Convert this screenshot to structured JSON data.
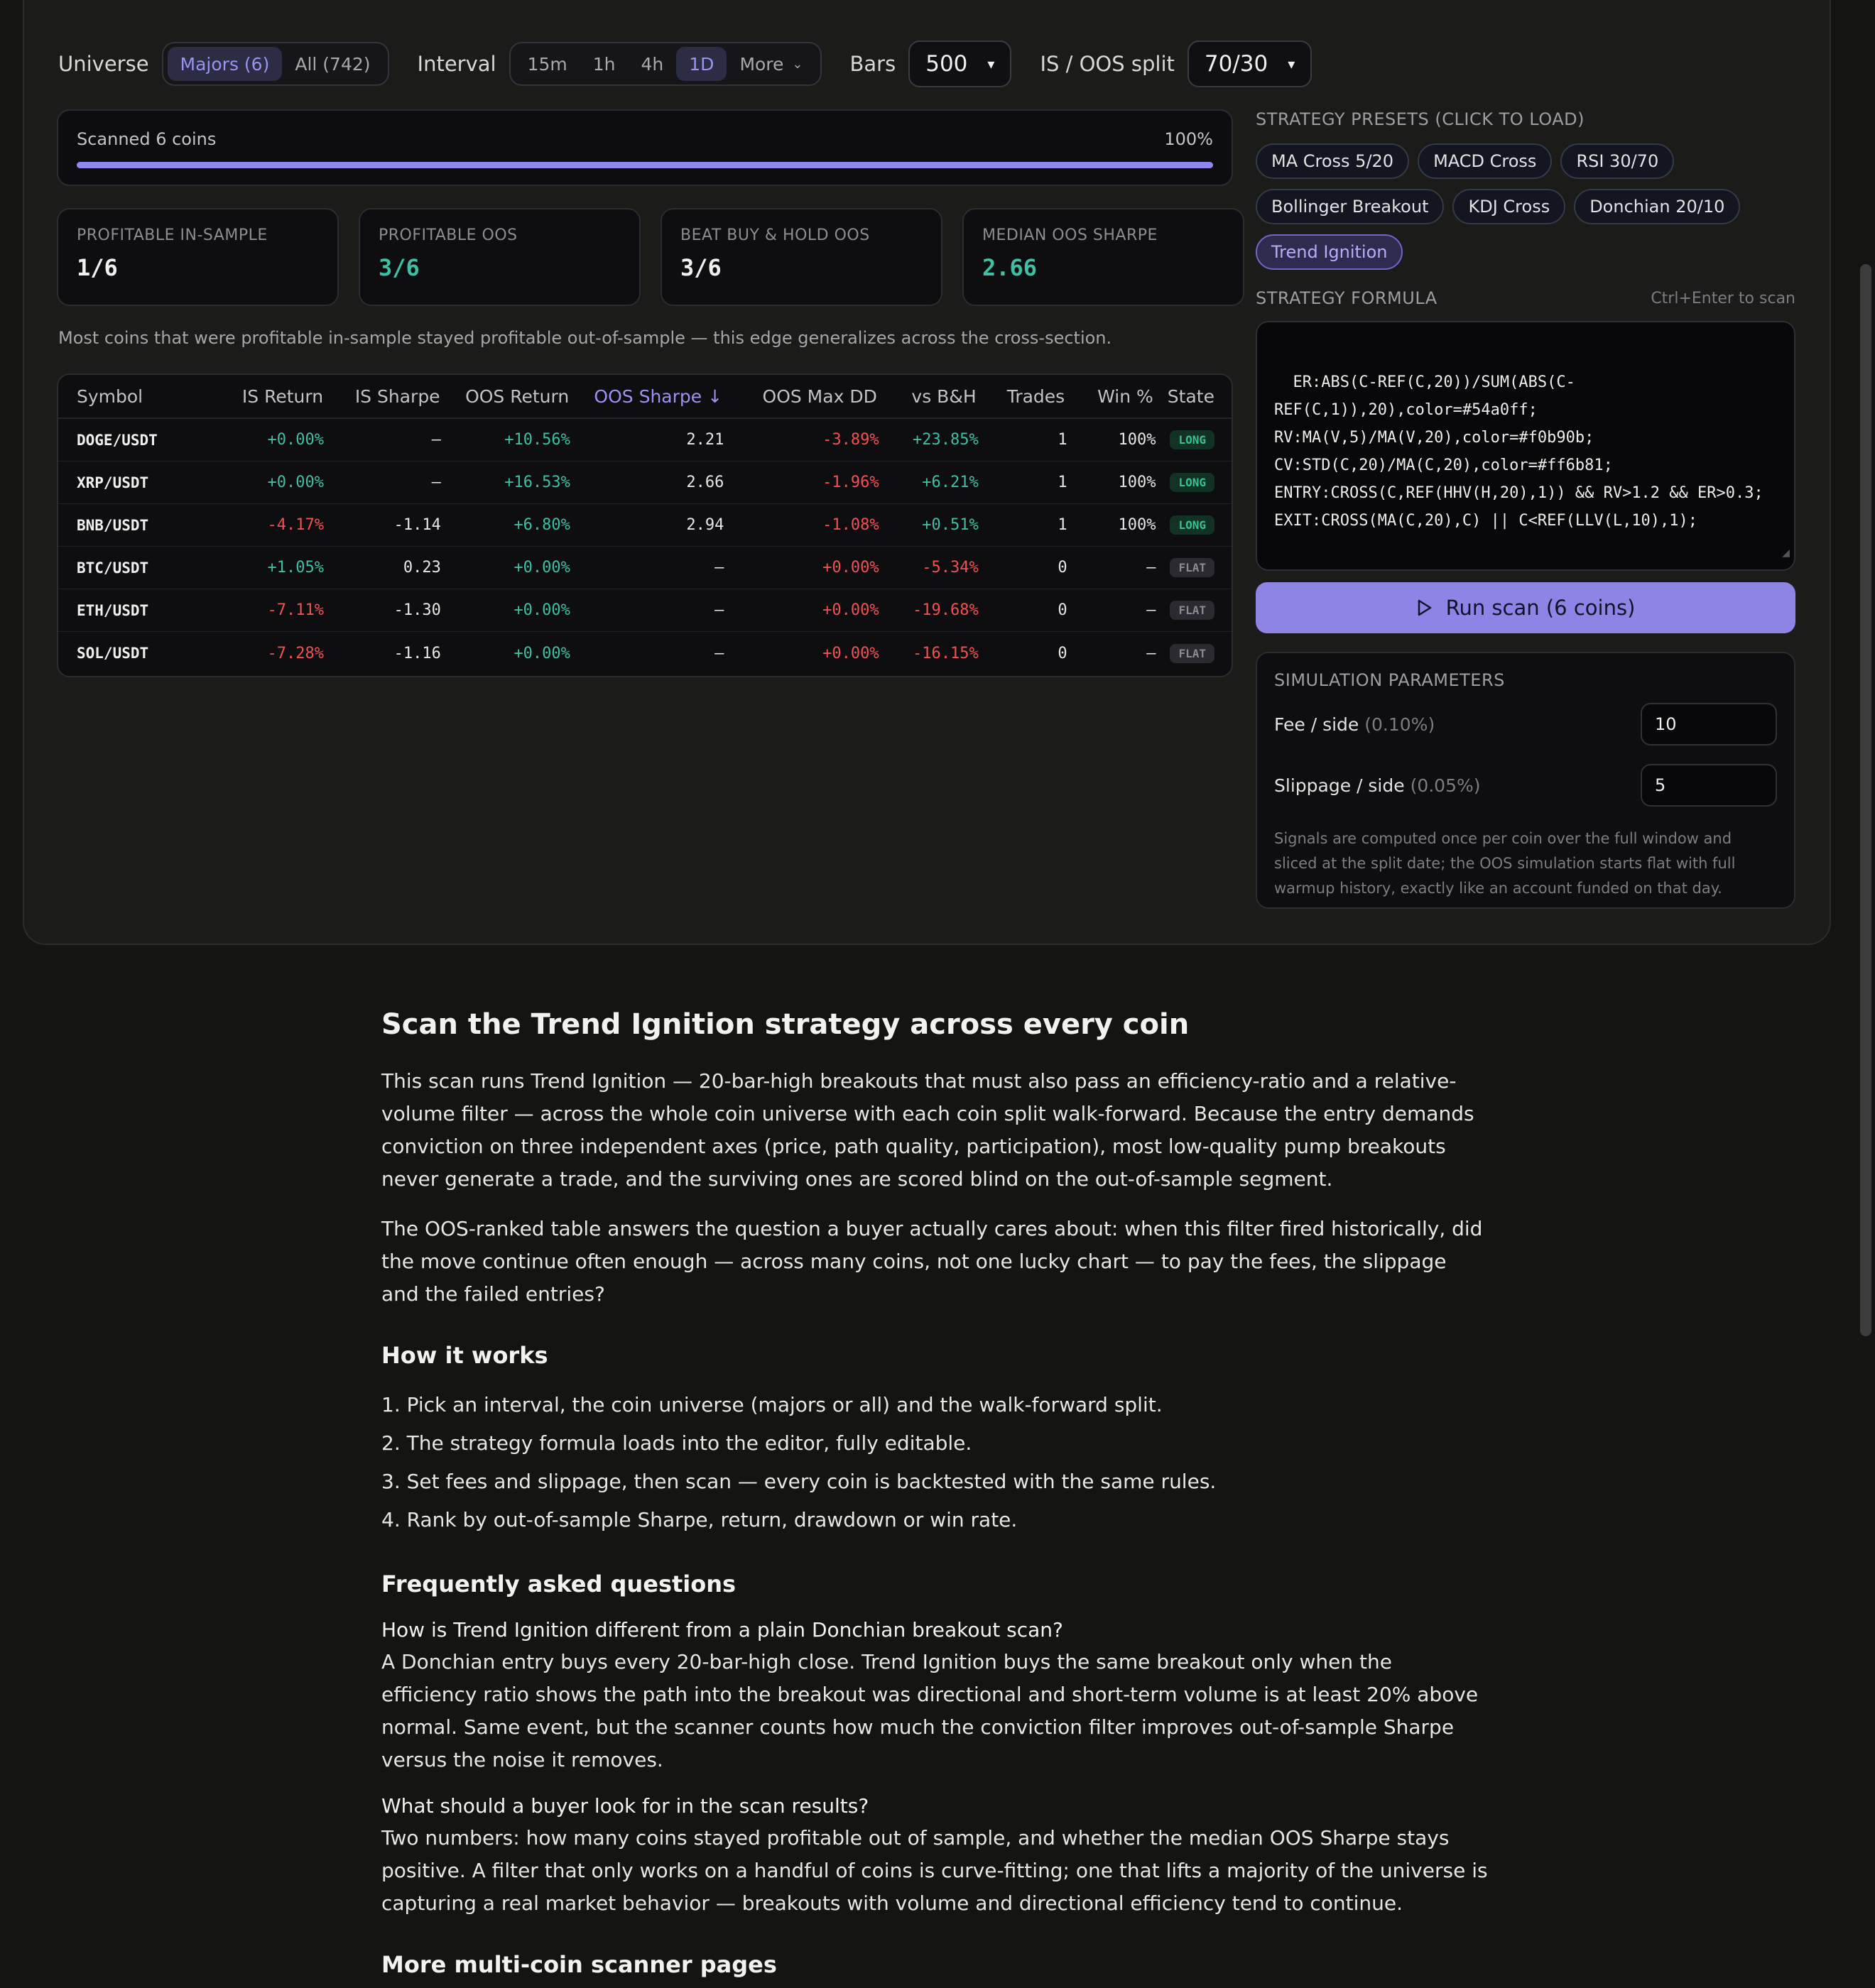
{
  "toolbar": {
    "universe_label": "Universe",
    "universe_options": [
      "Majors (6)",
      "All (742)"
    ],
    "interval_label": "Interval",
    "interval_options": [
      "15m",
      "1h",
      "4h",
      "1D"
    ],
    "interval_more": "More",
    "bars_label": "Bars",
    "bars_value": "500",
    "split_label": "IS / OOS split",
    "split_value": "70/30"
  },
  "progress": {
    "text": "Scanned 6 coins",
    "percent_label": "100%",
    "percent": 100
  },
  "stats": [
    {
      "label": "PROFITABLE IN-SAMPLE",
      "value": "1/6"
    },
    {
      "label": "PROFITABLE OOS",
      "value": "3/6"
    },
    {
      "label": "BEAT BUY & HOLD OOS",
      "value": "3/6"
    },
    {
      "label": "MEDIAN OOS SHARPE",
      "value": "2.66"
    }
  ],
  "summary": "Most coins that were profitable in-sample stayed profitable out-of-sample — this edge generalizes across the cross-section.",
  "table": {
    "headers": [
      "Symbol",
      "IS Return",
      "IS Sharpe",
      "OOS Return",
      "OOS Sharpe ↓",
      "OOS Max DD",
      "vs B&H",
      "Trades",
      "Win %",
      "State"
    ],
    "rows": [
      [
        "DOGE/USDT",
        "+0.00%",
        "—",
        "+10.56%",
        "2.21",
        "-3.89%",
        "+23.85%",
        "1",
        "100%",
        "LONG"
      ],
      [
        "XRP/USDT",
        "+0.00%",
        "—",
        "+16.53%",
        "2.66",
        "-1.96%",
        "+6.21%",
        "1",
        "100%",
        "LONG"
      ],
      [
        "BNB/USDT",
        "-4.17%",
        "-1.14",
        "+6.80%",
        "2.94",
        "-1.08%",
        "+0.51%",
        "1",
        "100%",
        "LONG"
      ],
      [
        "BTC/USDT",
        "+1.05%",
        "0.23",
        "+0.00%",
        "—",
        "+0.00%",
        "-5.34%",
        "0",
        "—",
        "FLAT"
      ],
      [
        "ETH/USDT",
        "-7.11%",
        "-1.30",
        "+0.00%",
        "—",
        "+0.00%",
        "-19.68%",
        "0",
        "—",
        "FLAT"
      ],
      [
        "SOL/USDT",
        "-7.28%",
        "-1.16",
        "+0.00%",
        "—",
        "+0.00%",
        "-16.15%",
        "0",
        "—",
        "FLAT"
      ]
    ]
  },
  "presets": {
    "heading": "STRATEGY PRESETS (CLICK TO LOAD)",
    "items": [
      "MA Cross 5/20",
      "MACD Cross",
      "RSI 30/70",
      "Bollinger Breakout",
      "KDJ Cross",
      "Donchian 20/10",
      "Trend Ignition"
    ]
  },
  "formula": {
    "heading": "STRATEGY FORMULA",
    "hint": "Ctrl+Enter to scan",
    "code": "ER:ABS(C-REF(C,20))/SUM(ABS(C-\nREF(C,1)),20),color=#54a0ff;\nRV:MA(V,5)/MA(V,20),color=#f0b90b;\nCV:STD(C,20)/MA(C,20),color=#ff6b81;\nENTRY:CROSS(C,REF(HHV(H,20),1)) && RV>1.2 && ER>0.3;\nEXIT:CROSS(MA(C,20),C) || C<REF(LLV(L,10),1);"
  },
  "run_button": "Run scan (6 coins)",
  "simulation": {
    "heading": "SIMULATION PARAMETERS",
    "fee_label": "Fee / side",
    "fee_hint": "(0.10%)",
    "fee_value": "10",
    "slip_label": "Slippage / side",
    "slip_hint": "(0.05%)",
    "slip_value": "5",
    "note": "Signals are computed once per coin over the full window and sliced at the split date; the OOS simulation starts flat with full warmup history, exactly like an account funded on that day."
  },
  "article": {
    "title": "Scan the Trend Ignition strategy across every coin",
    "p1": "This scan runs Trend Ignition — 20-bar-high breakouts that must also pass an efficiency-ratio and a relative-volume filter — across the whole coin universe with each coin split walk-forward. Because the entry demands conviction on three independent axes (price, path quality, participation), most low-quality pump breakouts never generate a trade, and the surviving ones are scored blind on the out-of-sample segment.",
    "p2": "The OOS-ranked table answers the question a buyer actually cares about: when this filter fired historically, did the move continue often enough — across many coins, not one lucky chart — to pay the fees, the slippage and the failed entries?",
    "how_title": "How it works",
    "steps": [
      "1. Pick an interval, the coin universe (majors or all) and the walk-forward split.",
      "2. The strategy formula loads into the editor, fully editable.",
      "3. Set fees and slippage, then scan — every coin is backtested with the same rules.",
      "4. Rank by out-of-sample Sharpe, return, drawdown or win rate."
    ],
    "faq_title": "Frequently asked questions",
    "q1": "How is Trend Ignition different from a plain Donchian breakout scan?",
    "a1": "A Donchian entry buys every 20-bar-high close. Trend Ignition buys the same breakout only when the efficiency ratio shows the path into the breakout was directional and short-term volume is at least 20% above normal. Same event, but the scanner counts how much the conviction filter improves out-of-sample Sharpe versus the noise it removes.",
    "q2": "What should a buyer look for in the scan results?",
    "a2": "Two numbers: how many coins stayed profitable out of sample, and whether the median OOS Sharpe stays positive. A filter that only works on a handful of coins is curve-fitting; one that lifts a majority of the universe is capturing a real market behavior — breakouts with volume and directional efficiency tend to continue.",
    "more_title": "More multi-coin scanner pages"
  }
}
